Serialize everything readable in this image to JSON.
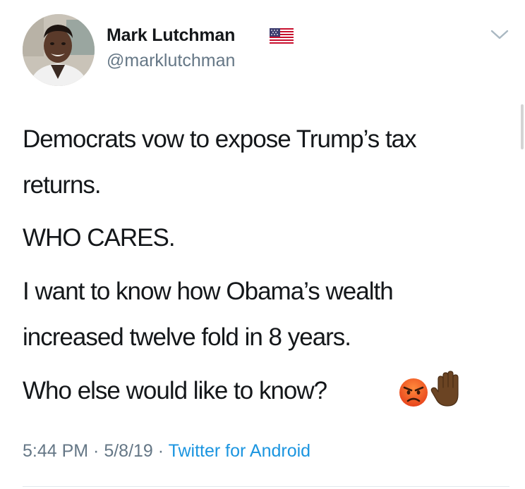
{
  "author": {
    "display_name": "Mark Lutchman",
    "handle": "@marklutchman",
    "flag_icon": "us-flag-icon",
    "avatar": "avatar-photo"
  },
  "tweet": {
    "lines": [
      "Democrats vow to expose Trump’s tax",
      "returns.",
      "WHO CARES.",
      "I want to know how Obama’s wealth",
      "increased twelve fold in 8 years.",
      "Who else would like to know?"
    ],
    "emojis": [
      "angry-face-icon",
      "raised-hand-icon"
    ]
  },
  "meta": {
    "time": "5:44 PM",
    "separator_1": " · ",
    "date": "5/8/19",
    "separator_2": " · ",
    "source": "Twitter for Android"
  },
  "colors": {
    "text": "#14171a",
    "secondary": "#657786",
    "link": "#1b95e0",
    "divider": "#e1e8ed"
  },
  "icons": {
    "menu": "chevron-down-icon"
  }
}
